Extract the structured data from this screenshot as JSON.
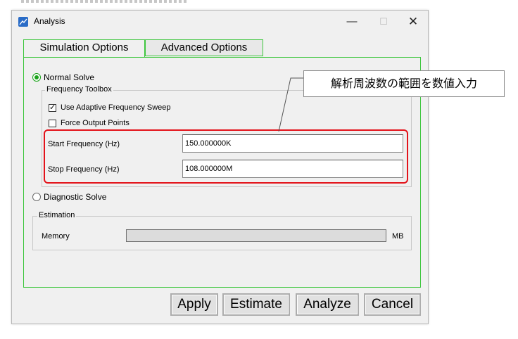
{
  "window": {
    "title": "Analysis",
    "controls": {
      "minimize": "—",
      "maximize": "☐",
      "close": "✕"
    }
  },
  "tabs": [
    {
      "label": "Simulation Options",
      "active": true
    },
    {
      "label": "Advanced Options",
      "active": false
    }
  ],
  "solve_modes": {
    "normal": {
      "label": "Normal Solve",
      "selected": true
    },
    "diagnostic": {
      "label": "Diagnostic Solve",
      "selected": false
    }
  },
  "frequency_toolbox": {
    "title": "Frequency Toolbox",
    "use_adaptive": {
      "label": "Use Adaptive Frequency Sweep",
      "checked": true,
      "mark": "✓"
    },
    "force_output": {
      "label": "Force Output Points",
      "checked": false
    },
    "start": {
      "label": "Start Frequency (Hz)",
      "value": "150.000000K"
    },
    "stop": {
      "label": "Stop Frequency (Hz)",
      "value": "108.000000M"
    }
  },
  "estimation": {
    "title": "Estimation",
    "memory_label": "Memory",
    "memory_unit": "MB"
  },
  "buttons": {
    "apply": "Apply",
    "estimate": "Estimate",
    "analyze": "Analyze",
    "cancel": "Cancel"
  },
  "annotation": {
    "text": "解析周波数の範囲を数値入力",
    "highlight_color": "#e3131b"
  },
  "colors": {
    "accent_green": "#3dc63d",
    "radio_green": "#1aa31a",
    "app_icon_blue": "#2a6cc7"
  }
}
